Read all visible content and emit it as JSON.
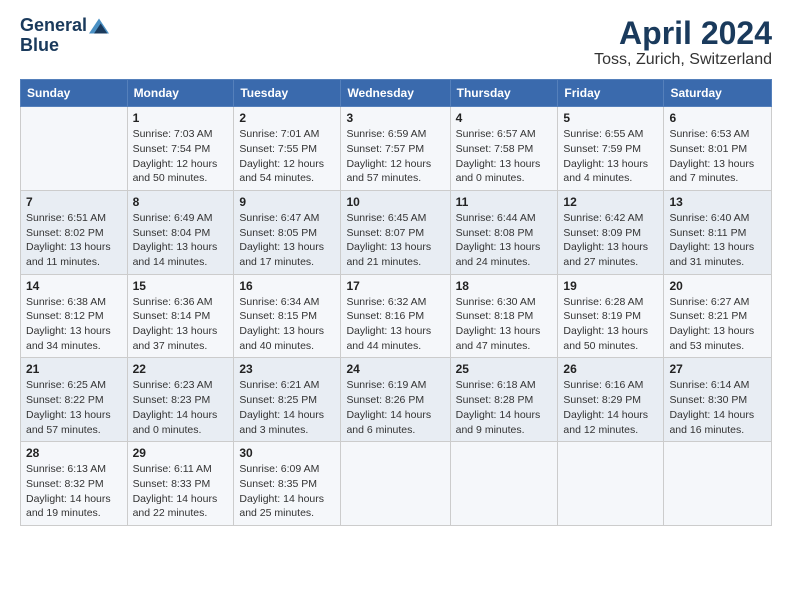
{
  "logo": {
    "line1": "General",
    "line2": "Blue"
  },
  "title": "April 2024",
  "subtitle": "Toss, Zurich, Switzerland",
  "days_of_week": [
    "Sunday",
    "Monday",
    "Tuesday",
    "Wednesday",
    "Thursday",
    "Friday",
    "Saturday"
  ],
  "weeks": [
    [
      {
        "num": "",
        "info": ""
      },
      {
        "num": "1",
        "info": "Sunrise: 7:03 AM\nSunset: 7:54 PM\nDaylight: 12 hours\nand 50 minutes."
      },
      {
        "num": "2",
        "info": "Sunrise: 7:01 AM\nSunset: 7:55 PM\nDaylight: 12 hours\nand 54 minutes."
      },
      {
        "num": "3",
        "info": "Sunrise: 6:59 AM\nSunset: 7:57 PM\nDaylight: 12 hours\nand 57 minutes."
      },
      {
        "num": "4",
        "info": "Sunrise: 6:57 AM\nSunset: 7:58 PM\nDaylight: 13 hours\nand 0 minutes."
      },
      {
        "num": "5",
        "info": "Sunrise: 6:55 AM\nSunset: 7:59 PM\nDaylight: 13 hours\nand 4 minutes."
      },
      {
        "num": "6",
        "info": "Sunrise: 6:53 AM\nSunset: 8:01 PM\nDaylight: 13 hours\nand 7 minutes."
      }
    ],
    [
      {
        "num": "7",
        "info": "Sunrise: 6:51 AM\nSunset: 8:02 PM\nDaylight: 13 hours\nand 11 minutes."
      },
      {
        "num": "8",
        "info": "Sunrise: 6:49 AM\nSunset: 8:04 PM\nDaylight: 13 hours\nand 14 minutes."
      },
      {
        "num": "9",
        "info": "Sunrise: 6:47 AM\nSunset: 8:05 PM\nDaylight: 13 hours\nand 17 minutes."
      },
      {
        "num": "10",
        "info": "Sunrise: 6:45 AM\nSunset: 8:07 PM\nDaylight: 13 hours\nand 21 minutes."
      },
      {
        "num": "11",
        "info": "Sunrise: 6:44 AM\nSunset: 8:08 PM\nDaylight: 13 hours\nand 24 minutes."
      },
      {
        "num": "12",
        "info": "Sunrise: 6:42 AM\nSunset: 8:09 PM\nDaylight: 13 hours\nand 27 minutes."
      },
      {
        "num": "13",
        "info": "Sunrise: 6:40 AM\nSunset: 8:11 PM\nDaylight: 13 hours\nand 31 minutes."
      }
    ],
    [
      {
        "num": "14",
        "info": "Sunrise: 6:38 AM\nSunset: 8:12 PM\nDaylight: 13 hours\nand 34 minutes."
      },
      {
        "num": "15",
        "info": "Sunrise: 6:36 AM\nSunset: 8:14 PM\nDaylight: 13 hours\nand 37 minutes."
      },
      {
        "num": "16",
        "info": "Sunrise: 6:34 AM\nSunset: 8:15 PM\nDaylight: 13 hours\nand 40 minutes."
      },
      {
        "num": "17",
        "info": "Sunrise: 6:32 AM\nSunset: 8:16 PM\nDaylight: 13 hours\nand 44 minutes."
      },
      {
        "num": "18",
        "info": "Sunrise: 6:30 AM\nSunset: 8:18 PM\nDaylight: 13 hours\nand 47 minutes."
      },
      {
        "num": "19",
        "info": "Sunrise: 6:28 AM\nSunset: 8:19 PM\nDaylight: 13 hours\nand 50 minutes."
      },
      {
        "num": "20",
        "info": "Sunrise: 6:27 AM\nSunset: 8:21 PM\nDaylight: 13 hours\nand 53 minutes."
      }
    ],
    [
      {
        "num": "21",
        "info": "Sunrise: 6:25 AM\nSunset: 8:22 PM\nDaylight: 13 hours\nand 57 minutes."
      },
      {
        "num": "22",
        "info": "Sunrise: 6:23 AM\nSunset: 8:23 PM\nDaylight: 14 hours\nand 0 minutes."
      },
      {
        "num": "23",
        "info": "Sunrise: 6:21 AM\nSunset: 8:25 PM\nDaylight: 14 hours\nand 3 minutes."
      },
      {
        "num": "24",
        "info": "Sunrise: 6:19 AM\nSunset: 8:26 PM\nDaylight: 14 hours\nand 6 minutes."
      },
      {
        "num": "25",
        "info": "Sunrise: 6:18 AM\nSunset: 8:28 PM\nDaylight: 14 hours\nand 9 minutes."
      },
      {
        "num": "26",
        "info": "Sunrise: 6:16 AM\nSunset: 8:29 PM\nDaylight: 14 hours\nand 12 minutes."
      },
      {
        "num": "27",
        "info": "Sunrise: 6:14 AM\nSunset: 8:30 PM\nDaylight: 14 hours\nand 16 minutes."
      }
    ],
    [
      {
        "num": "28",
        "info": "Sunrise: 6:13 AM\nSunset: 8:32 PM\nDaylight: 14 hours\nand 19 minutes."
      },
      {
        "num": "29",
        "info": "Sunrise: 6:11 AM\nSunset: 8:33 PM\nDaylight: 14 hours\nand 22 minutes."
      },
      {
        "num": "30",
        "info": "Sunrise: 6:09 AM\nSunset: 8:35 PM\nDaylight: 14 hours\nand 25 minutes."
      },
      {
        "num": "",
        "info": ""
      },
      {
        "num": "",
        "info": ""
      },
      {
        "num": "",
        "info": ""
      },
      {
        "num": "",
        "info": ""
      }
    ]
  ]
}
